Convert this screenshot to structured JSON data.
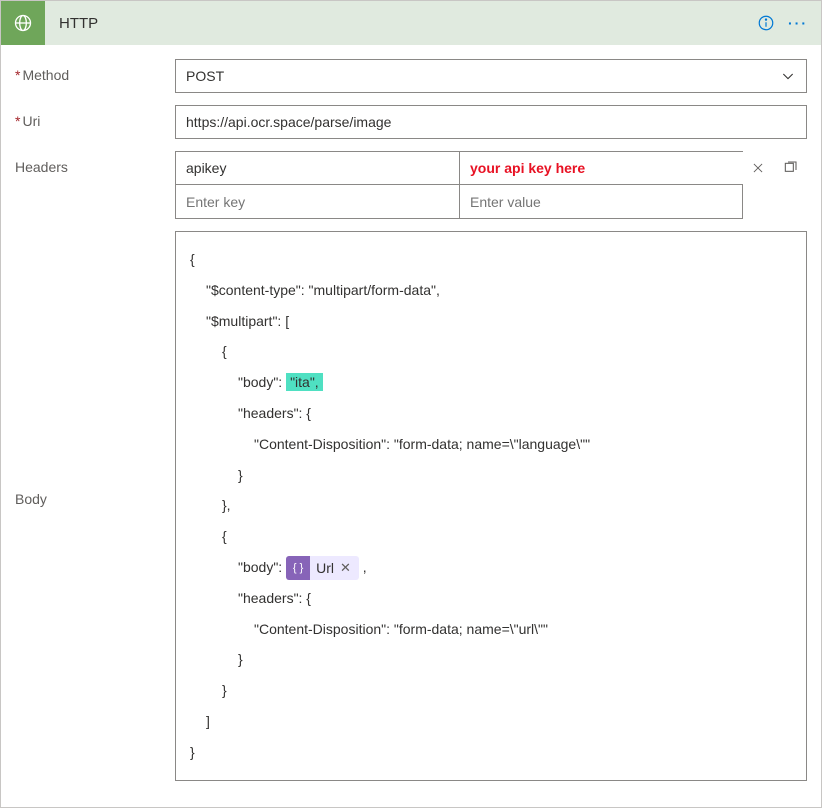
{
  "header": {
    "title": "HTTP"
  },
  "fields": {
    "method": {
      "label": "Method",
      "value": "POST"
    },
    "uri": {
      "label": "Uri",
      "value": "https://api.ocr.space/parse/image"
    },
    "headers": {
      "label": "Headers",
      "row1": {
        "key": "apikey",
        "value_placeholder": "your api key here"
      },
      "row2": {
        "key_placeholder": "Enter key",
        "value_placeholder": "Enter value"
      }
    },
    "body": {
      "label": "Body",
      "lines": {
        "l0": "{",
        "l1": "\"$content-type\": \"multipart/form-data\",",
        "l2": "\"$multipart\": [",
        "l3": "{",
        "l4a": "\"body\": ",
        "l4b": "\"ita\",",
        "l5": "\"headers\": {",
        "l6": "\"Content-Disposition\": \"form-data; name=\\\"language\\\"\"",
        "l7": "}",
        "l8": "},",
        "l9": "{",
        "l10a": "\"body\": ",
        "l10_token": "Url",
        "l10c": " ,",
        "l11": "\"headers\": {",
        "l12": "\"Content-Disposition\": \"form-data; name=\\\"url\\\"\"",
        "l13": "}",
        "l14": "}",
        "l15": "]",
        "l16": "}"
      }
    }
  }
}
